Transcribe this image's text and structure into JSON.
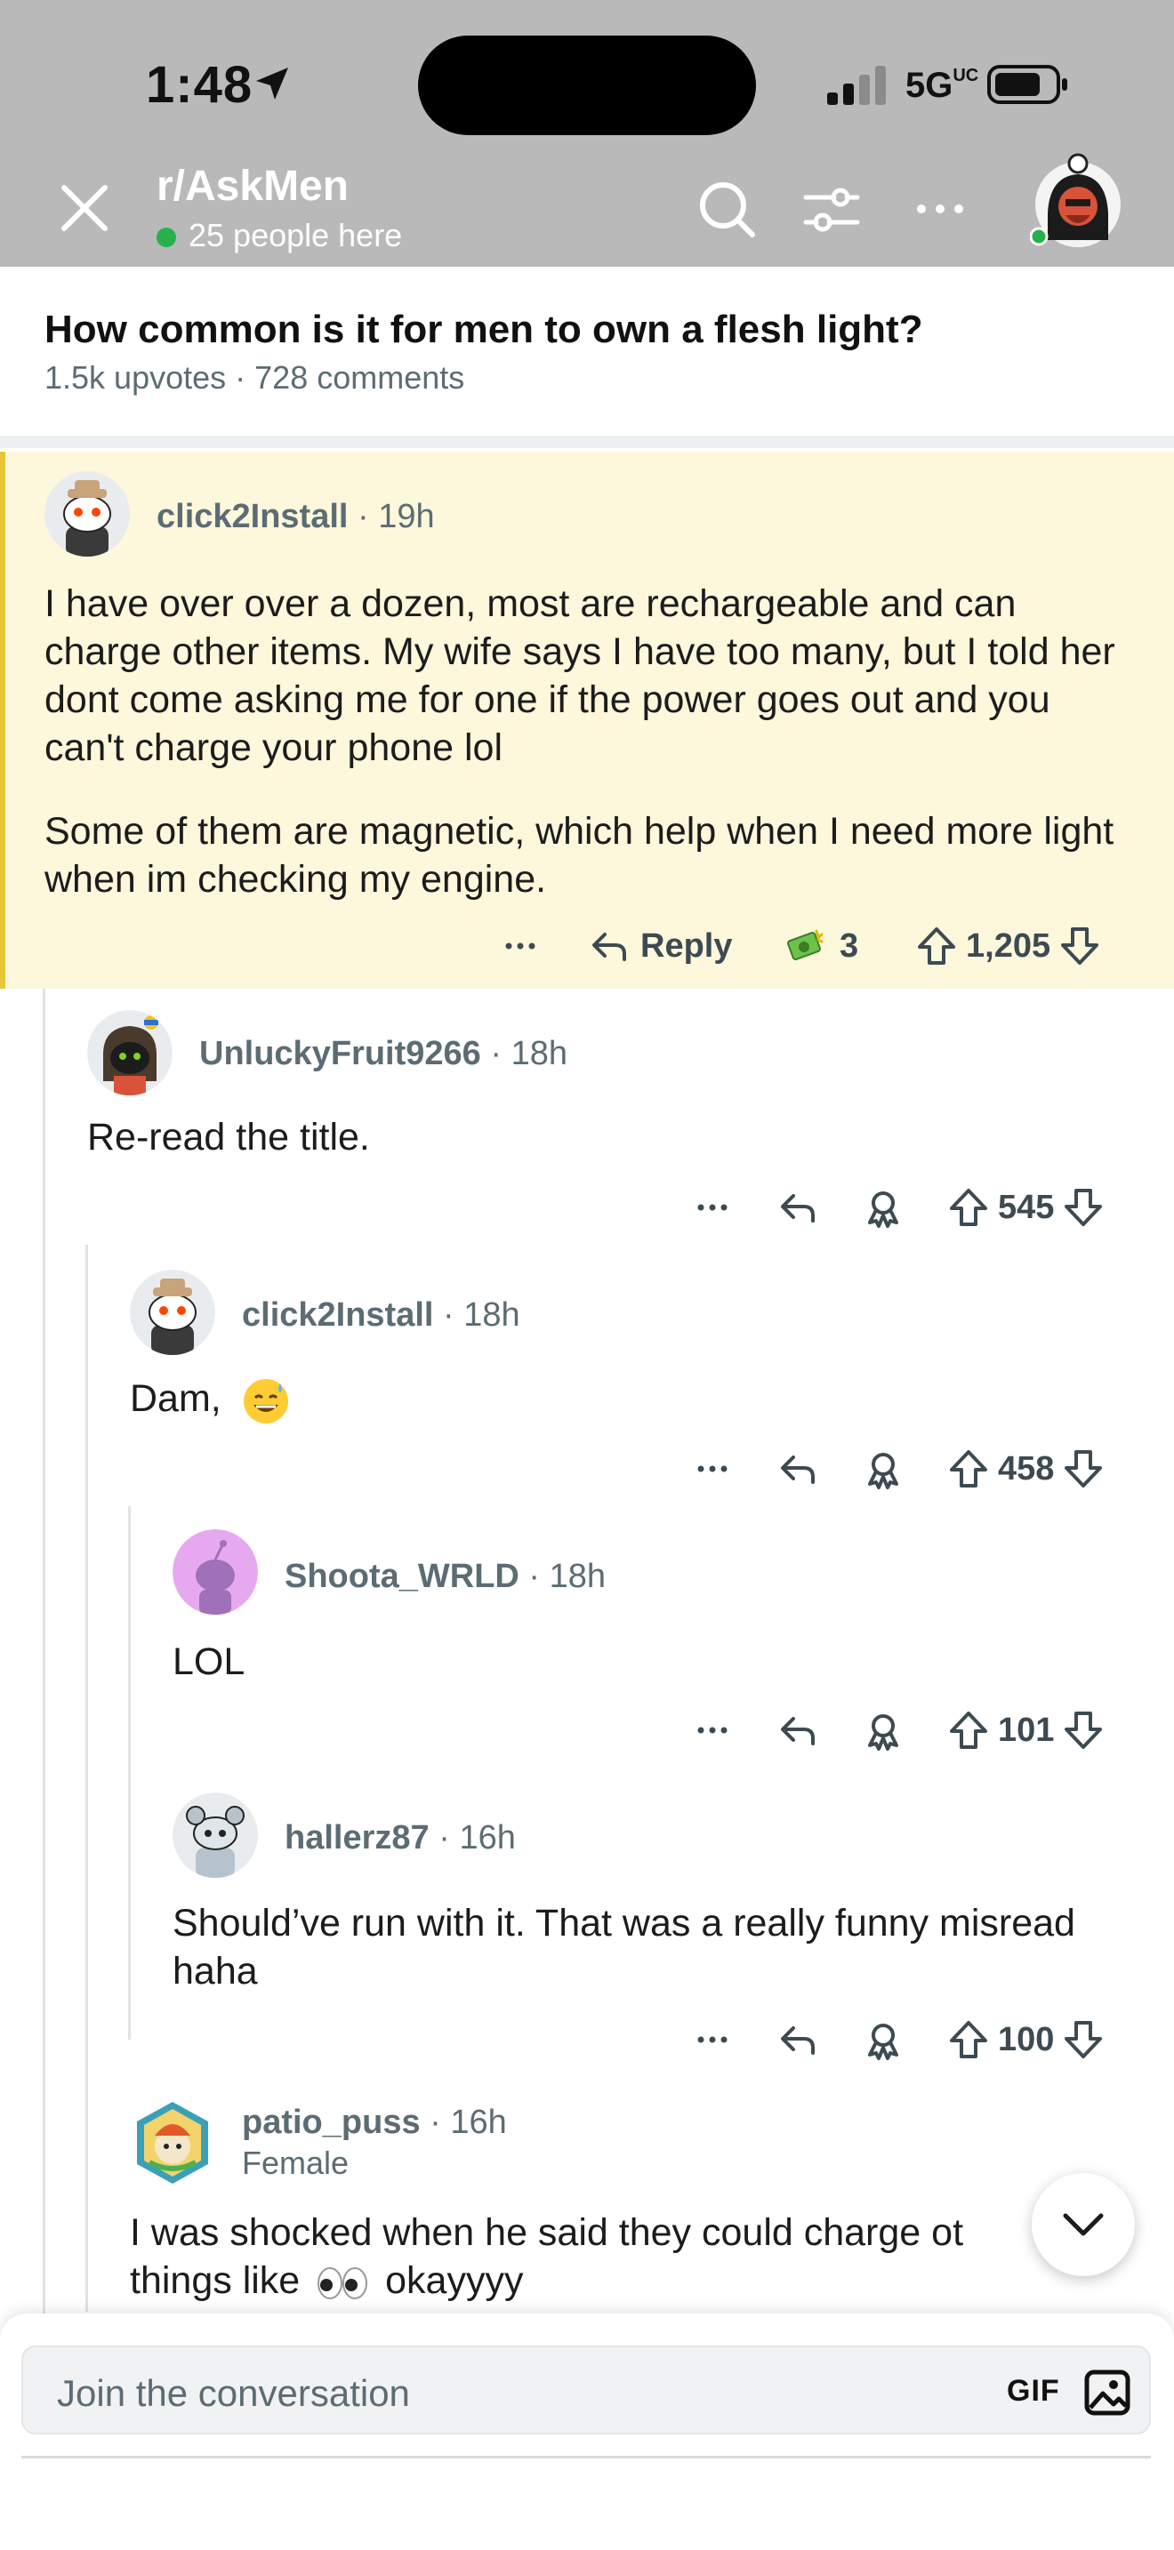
{
  "status_bar": {
    "time": "1:48",
    "network": "5G",
    "network_badge": "UC"
  },
  "header": {
    "subreddit": "r/AskMen",
    "online": "25 people here"
  },
  "post": {
    "title": "How common is it for men to own a flesh light?",
    "upvotes": "1.5k upvotes",
    "comments": "728 comments"
  },
  "comments": [
    {
      "user": "click2Install",
      "age": "19h",
      "body": [
        "I have over over a dozen, most are rechargeable and can charge other items. My wife says I have too many, but I told her dont come asking me for one if the power goes out and you can't charge your phone lol",
        "Some of them are magnetic, which help when I need more light when im checking my engine."
      ],
      "reply_label": "Reply",
      "awards": "3",
      "score": "1,205"
    },
    {
      "user": "UnluckyFruit9266",
      "age": "18h",
      "body": "Re-read the title.",
      "score": "545"
    },
    {
      "user": "click2Install",
      "age": "18h",
      "body": "Dam,",
      "score": "458"
    },
    {
      "user": "Shoota_WRLD",
      "age": "18h",
      "body": "LOL",
      "score": "101"
    },
    {
      "user": "hallerz87",
      "age": "16h",
      "body": "Should’ve run with it. That was a really funny misread haha",
      "score": "100"
    },
    {
      "user": "patio_puss",
      "age": "16h",
      "flair": "Female",
      "body_line1": "I was shocked when he said they could charge ot",
      "body_line2_a": "things like",
      "body_line2_b": "okayyyy"
    }
  ],
  "composer": {
    "placeholder": "Join the conversation",
    "gif_label": "GIF"
  },
  "colors": {
    "highlight_bg": "#fdf7dc",
    "highlight_border": "#e6c63a",
    "header_bg": "#b9b9b9",
    "meta_text": "#5c6c74",
    "online_dot": "#27b14a"
  }
}
